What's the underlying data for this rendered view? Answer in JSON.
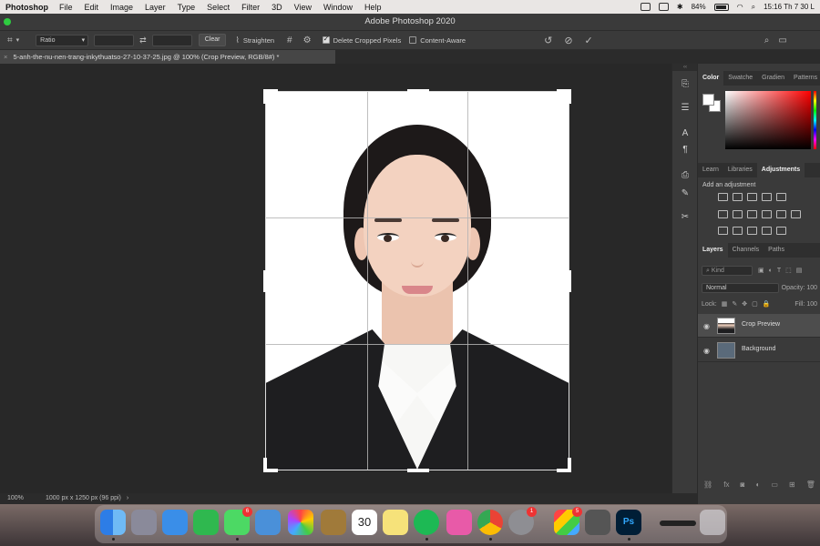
{
  "menubar": {
    "app_name": "Photoshop",
    "items": [
      "File",
      "Edit",
      "Image",
      "Layer",
      "Type",
      "Select",
      "Filter",
      "3D",
      "View",
      "Window",
      "Help"
    ],
    "battery": "84%",
    "clock": "15:16 Th 7 30 L"
  },
  "window": {
    "title": "Adobe Photoshop 2020"
  },
  "options_bar": {
    "ratio_label": "Ratio",
    "clear_label": "Clear",
    "straighten_label": "Straighten",
    "delete_cropped_label": "Delete Cropped Pixels",
    "delete_cropped_checked": true,
    "content_aware_label": "Content-Aware",
    "content_aware_checked": false
  },
  "document": {
    "tab_title": "5-anh-the-nu-nen-trang-inkythuatso-27-10-37-25.jpg @ 100% (Crop Preview, RGB/8#) *"
  },
  "status_bar": {
    "zoom": "100%",
    "info": "1000 px x 1250 px (96 ppi)",
    "arrow": "›"
  },
  "panels": {
    "color_tabs": [
      "Color",
      "Swatche",
      "Gradien",
      "Patterns"
    ],
    "learn_tabs": [
      "Learn",
      "Libraries",
      "Adjustments"
    ],
    "adjustments_hint": "Add an adjustment",
    "layers_tabs": [
      "Layers",
      "Channels",
      "Paths"
    ],
    "kind_placeholder": "Kind",
    "blend_mode": "Normal",
    "opacity_label": "Opacity:",
    "opacity_value": "100",
    "lock_label": "Lock:",
    "fill_label": "Fill:",
    "fill_value": "100",
    "layers": [
      {
        "name": "Crop Preview",
        "selected": true
      },
      {
        "name": "Background",
        "selected": false
      }
    ]
  },
  "dock": {
    "calendar_day": "30",
    "messages_badge": "6",
    "settings_badge": "1",
    "apps_badge": "5",
    "photoshop_label": "Ps",
    "accent_color": "#31a8ff"
  }
}
